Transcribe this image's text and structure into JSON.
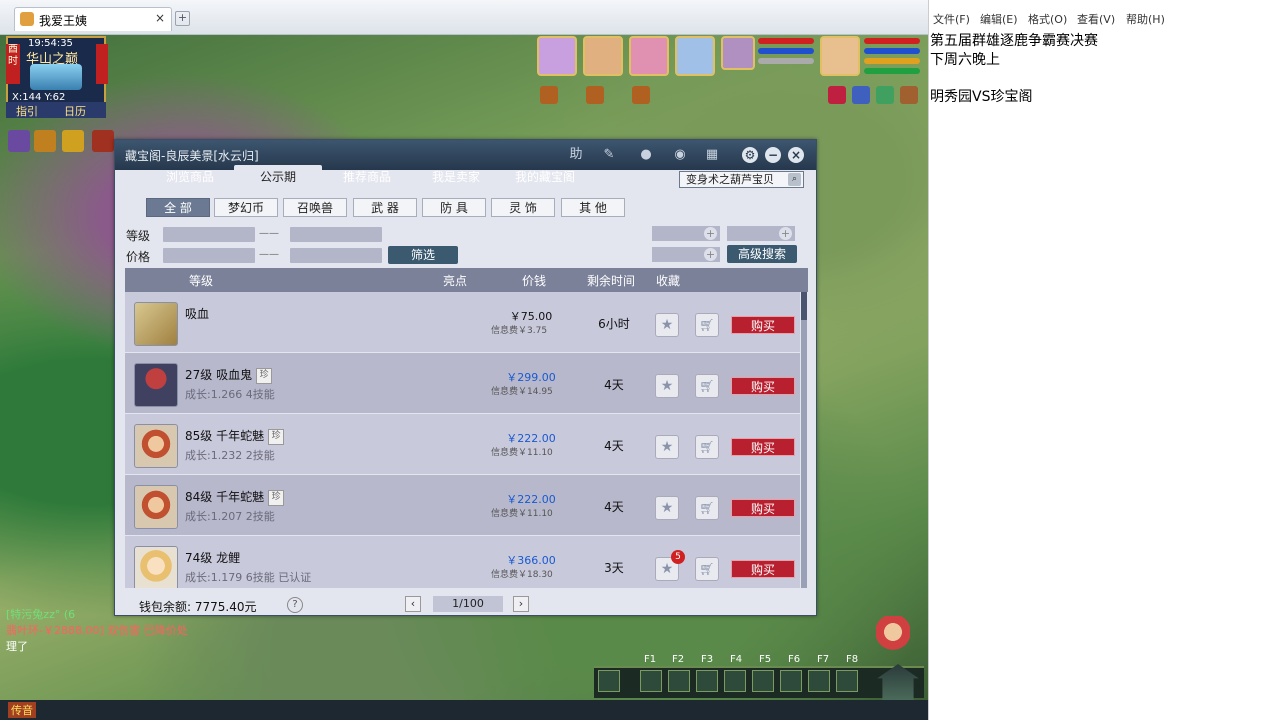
{
  "browser": {
    "tab_title": "我爱王姨",
    "close": "×",
    "new_tab": "+"
  },
  "minimap": {
    "time": "19:54:35",
    "location": "华山之巅",
    "coords": "X:144 Y:62",
    "btn_guide": "指引",
    "btn_calendar": "日历",
    "side_text": "酉时"
  },
  "chat": {
    "line1": "[特污兔zz° (6",
    "line2": "翡叶环-￥2888.00] 双伤害 已降价处",
    "line3": "理了",
    "voice_btn": "传音"
  },
  "skills": {
    "fkeys": [
      "F1",
      "F2",
      "F3",
      "F4",
      "F5",
      "F6",
      "F7",
      "F8"
    ]
  },
  "shop": {
    "title": "藏宝阁-良辰美景[水云归]",
    "nav_tabs": [
      "浏览商品",
      "公示期",
      "推荐商品",
      "我是卖家",
      "我的藏宝阁"
    ],
    "active_tab": "公示期",
    "search_value": "变身术之葫芦宝贝",
    "categories": [
      "全 部",
      "梦幻币",
      "召唤兽",
      "武 器",
      "防 具",
      "灵 饰",
      "其 他"
    ],
    "filter": {
      "level_label": "等级",
      "price_label": "价格",
      "dash": "——",
      "filter_btn": "筛选",
      "advanced_btn": "高级搜索"
    },
    "columns": {
      "level": "等级",
      "highlight": "亮点",
      "price": "价钱",
      "time": "剩余时间",
      "fav": "收藏"
    },
    "rows": [
      {
        "name": "吸血",
        "sub": "",
        "tag": "",
        "price": "￥75.00",
        "fee": "信息费￥3.75",
        "time": "6小时",
        "badge": "",
        "buy": "购买"
      },
      {
        "name": "27级  吸血鬼",
        "sub": "成长:1.266 4技能",
        "tag": "珍",
        "price": "￥299.00",
        "fee": "信息费￥14.95",
        "time": "4天",
        "badge": "",
        "buy": "购买"
      },
      {
        "name": "85级  千年蛇魅",
        "sub": "成长:1.232 2技能",
        "tag": "珍",
        "price": "￥222.00",
        "fee": "信息费￥11.10",
        "time": "4天",
        "badge": "",
        "buy": "购买"
      },
      {
        "name": "84级  千年蛇魅",
        "sub": "成长:1.207 2技能",
        "tag": "珍",
        "price": "￥222.00",
        "fee": "信息费￥11.10",
        "time": "4天",
        "badge": "",
        "buy": "购买"
      },
      {
        "name": "74级  龙鲤",
        "sub": "成长:1.179 6技能 已认证",
        "tag": "",
        "price": "￥366.00",
        "fee": "信息费￥18.30",
        "time": "3天",
        "badge": "5",
        "buy": "购买"
      }
    ],
    "wallet_label": "钱包余额:",
    "wallet_value": "7775.40元",
    "help": "?",
    "page": "1/100",
    "prev": "‹",
    "next": "›"
  },
  "notepad": {
    "menu": [
      "文件(F)",
      "编辑(E)",
      "格式(O)",
      "查看(V)",
      "帮助(H)"
    ],
    "lines": [
      "第五届群雄逐鹿争霸赛决赛",
      "下周六晚上",
      "",
      "明秀园VS珍宝阁"
    ]
  },
  "colors": {
    "buy": "#b82030",
    "title_bar": "#26384c",
    "price_blue": "#1a5ad0"
  }
}
